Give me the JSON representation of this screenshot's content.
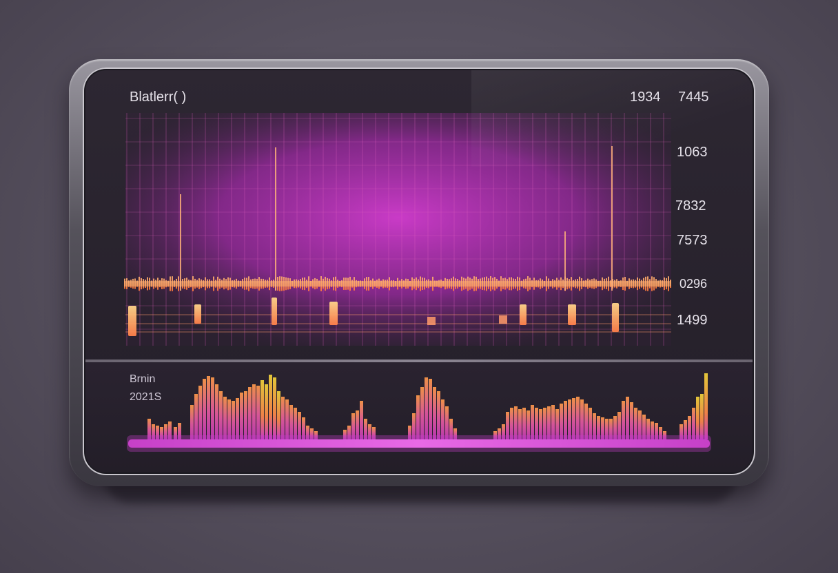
{
  "top_panel": {
    "title": "Blatlerr( )",
    "header_value_1": "1934",
    "header_value_2": "7445",
    "right_values": [
      "1063",
      "7832",
      "7573",
      "0296",
      "1499"
    ]
  },
  "bottom_panel": {
    "label": "Brnin",
    "sub_label": "2021S"
  },
  "colors": {
    "accent": "#d23ccf",
    "orange": "#ff9a4a",
    "yellow": "#f2d33a",
    "glow": "#c640c8"
  }
}
